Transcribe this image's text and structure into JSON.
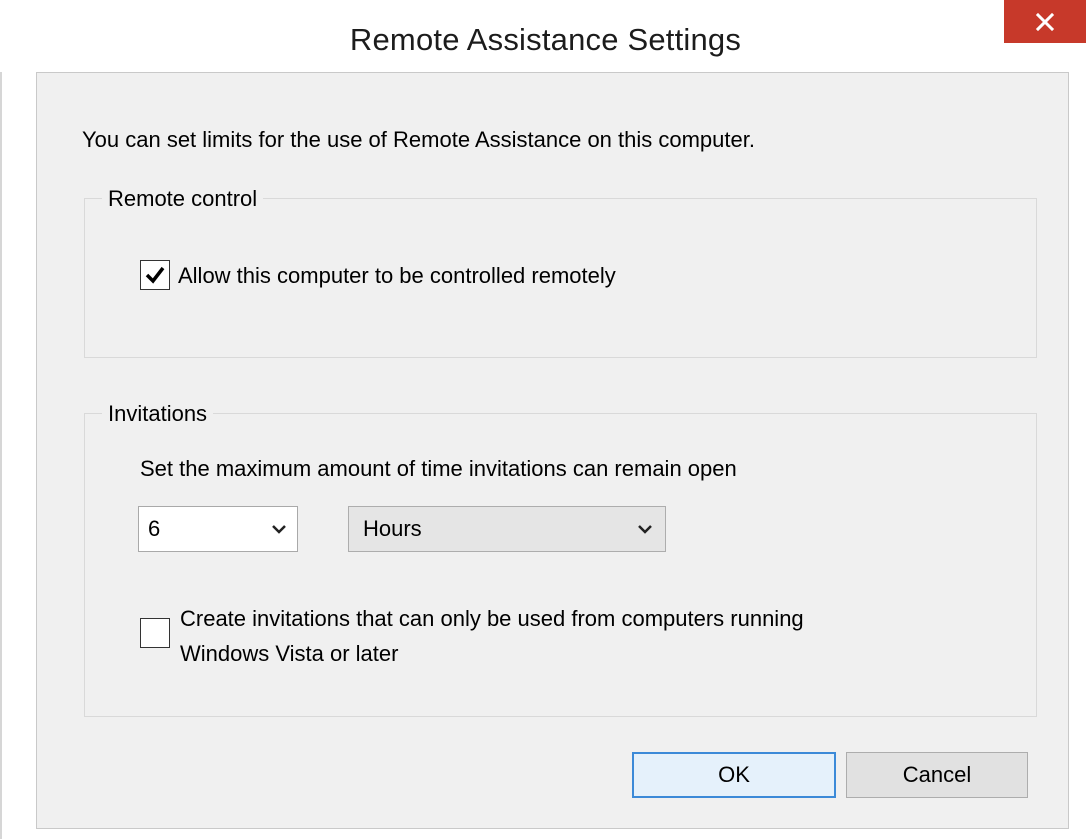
{
  "window": {
    "title": "Remote Assistance Settings"
  },
  "intro_text": "You can set limits for the use of Remote Assistance on this computer.",
  "remote_control": {
    "group_label": "Remote control",
    "allow_label": "Allow this computer to be controlled remotely",
    "allow_checked": true
  },
  "invitations": {
    "group_label": "Invitations",
    "max_time_label": "Set the maximum amount of time invitations can remain open",
    "amount": {
      "selected": "6"
    },
    "unit": {
      "selected": "Hours"
    },
    "vista_label_line1": "Create invitations that can only be used from computers running",
    "vista_label_line2": "Windows Vista or later",
    "vista_checked": false
  },
  "buttons": {
    "ok_label": "OK",
    "cancel_label": "Cancel"
  },
  "icons": {
    "close": "close-icon",
    "checkmark": "checkmark-icon",
    "dropdown": "chevron-down-icon"
  },
  "colors": {
    "close_button": "#c7392a",
    "dialog_background": "#f0f0f0",
    "ok_border": "#3c8ad8",
    "ok_background": "#e5f1fb"
  }
}
